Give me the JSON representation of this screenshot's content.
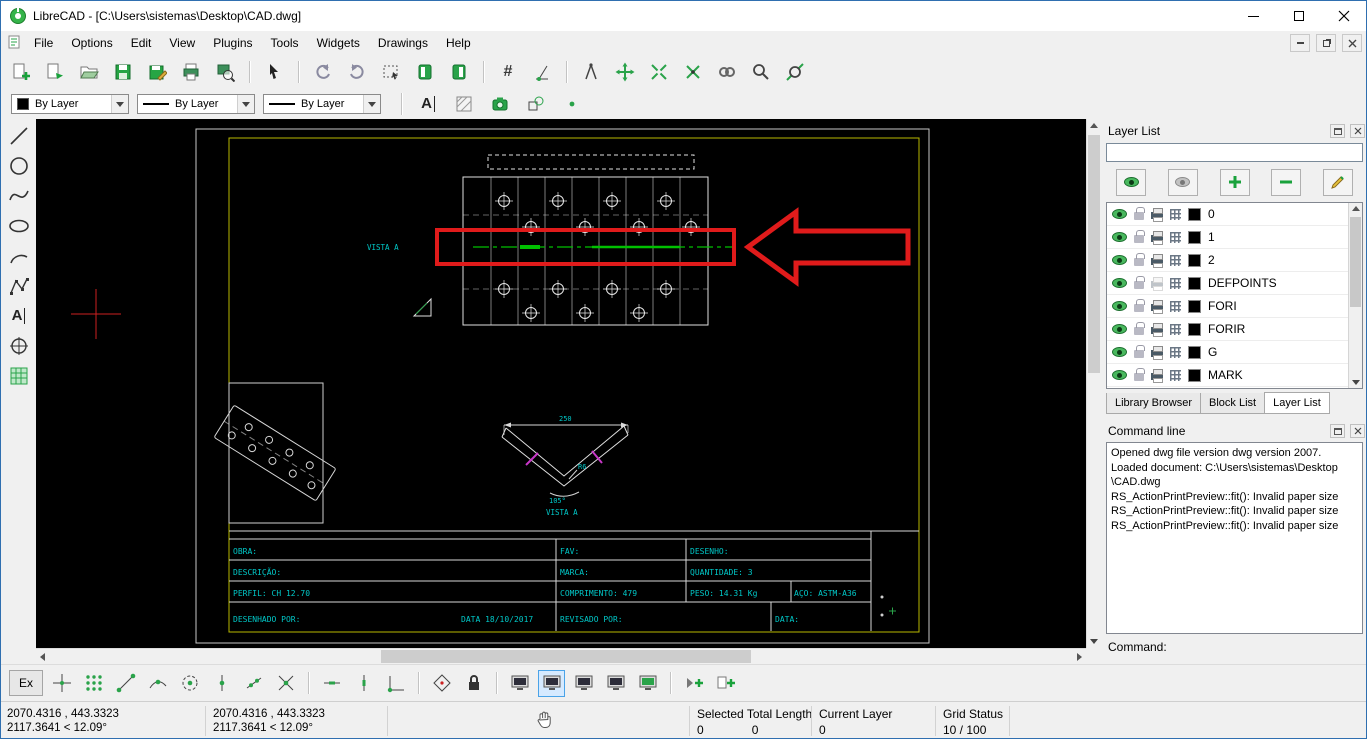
{
  "window": {
    "title": "LibreCAD - [C:\\Users\\sistemas\\Desktop\\CAD.dwg]"
  },
  "menu": {
    "items": [
      "File",
      "Options",
      "Edit",
      "View",
      "Plugins",
      "Tools",
      "Widgets",
      "Drawings",
      "Help"
    ]
  },
  "pen_toolbar": {
    "color": "By Layer",
    "width": "By Layer",
    "style": "By Layer"
  },
  "icons": {
    "mtext": "A",
    "grid": "#"
  },
  "layer_dock": {
    "title": "Layer List",
    "search_value": "",
    "layers": [
      {
        "name": "0"
      },
      {
        "name": "1"
      },
      {
        "name": "2"
      },
      {
        "name": "DEFPOINTS"
      },
      {
        "name": "FORI"
      },
      {
        "name": "FORIR"
      },
      {
        "name": "G"
      },
      {
        "name": "MARK"
      }
    ],
    "tabs": [
      "Library Browser",
      "Block List",
      "Layer List"
    ],
    "active_tab": "Layer List"
  },
  "command_dock": {
    "title": "Command line",
    "log": [
      "Opened dwg file version dwg version 2007.",
      "Loaded document: C:\\Users\\sistemas\\Desktop",
      "\\CAD.dwg",
      "RS_ActionPrintPreview::fit(): Invalid paper size",
      "RS_ActionPrintPreview::fit(): Invalid paper size",
      "RS_ActionPrintPreview::fit(): Invalid paper size"
    ],
    "prompt": "Command:"
  },
  "snapbar": {
    "ex": "Ex"
  },
  "statusbar": {
    "abs_coords": "2070.4316 , 443.3323",
    "abs_polar": "2117.3641 < 12.09°",
    "rel_coords": "2070.4316 , 443.3323",
    "rel_polar": "2117.3641 < 12.09°",
    "selected_label": "Selected Total Length",
    "selected_count": "0",
    "selected_length": "0",
    "current_layer_label": "Current Layer",
    "current_layer_value": "0",
    "grid_label": "Grid Status",
    "grid_value": "10 / 100"
  },
  "drawing": {
    "vista_a_left": "VISTA A",
    "vista_a_bottom": "VISTA A",
    "dim_width": "250",
    "dim_radius": "R6",
    "dim_angle": "105°",
    "colors": {
      "line": "#e0e0e0",
      "centerline_green": "#00c000",
      "highlight_red": "#e01b1b",
      "cad_text_cyan": "#00c8c8",
      "sheet_border_yellow": "#b9b900",
      "tick_magenta": "#c837c8"
    },
    "title_block": {
      "obra": "OBRA:",
      "fav": "FAV:",
      "desenho": "DESENHO:",
      "descricao": "DESCRIÇÃO:",
      "marca": "MARCA:",
      "quantidade": "QUANTIDADE:  3",
      "perfil": "PERFIL:  CH 12.70",
      "comprimento": "COMPRIMENTO:  479",
      "peso": "PESO:  14.31 Kg",
      "aco": "AÇO: ASTM-A36",
      "desenhado_por": "DESENHADO POR:",
      "data_value": "DATA 18/10/2017",
      "revisado_por": "REVISADO POR:",
      "data_label": "DATA:"
    }
  }
}
